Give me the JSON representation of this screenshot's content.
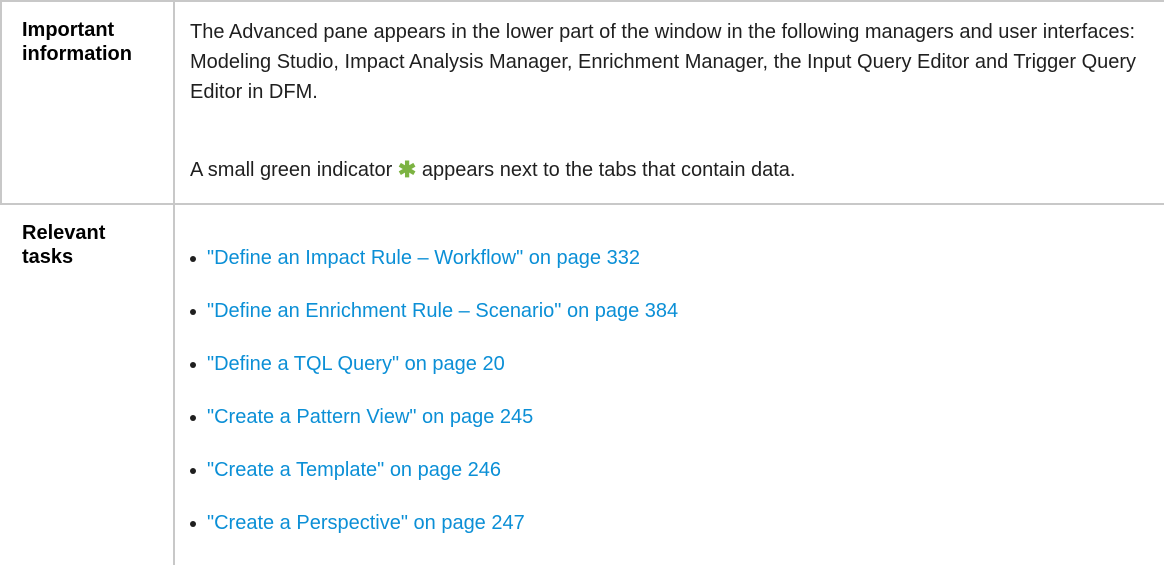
{
  "rows": {
    "important": {
      "label_line1": "Important",
      "label_line2": "information",
      "paragraph1": "The Advanced pane appears in the lower part of the window in the following managers and user interfaces: Modeling Studio, Impact Analysis Manager, Enrichment Manager, the Input Query Editor and Trigger Query Editor in DFM.",
      "paragraph2_before": "A small green indicator ",
      "paragraph2_icon": "✱",
      "paragraph2_after": " appears next to the tabs that contain data."
    },
    "relevant": {
      "label_line1": "Relevant",
      "label_line2": "tasks",
      "links": [
        "\"Define an Impact Rule – Workflow\" on page 332",
        "\"Define an Enrichment Rule – Scenario\" on page 384",
        "\"Define a TQL Query\" on page 20",
        "\"Create a Pattern View\" on page 245",
        "\"Create a Template\" on page 246",
        "\"Create a Perspective\" on page 247"
      ]
    }
  },
  "colors": {
    "link": "#0b8fd6",
    "indicator": "#7cb342",
    "border": "#c8c8c8"
  },
  "icons": {
    "indicator": "green-asterisk-icon"
  }
}
